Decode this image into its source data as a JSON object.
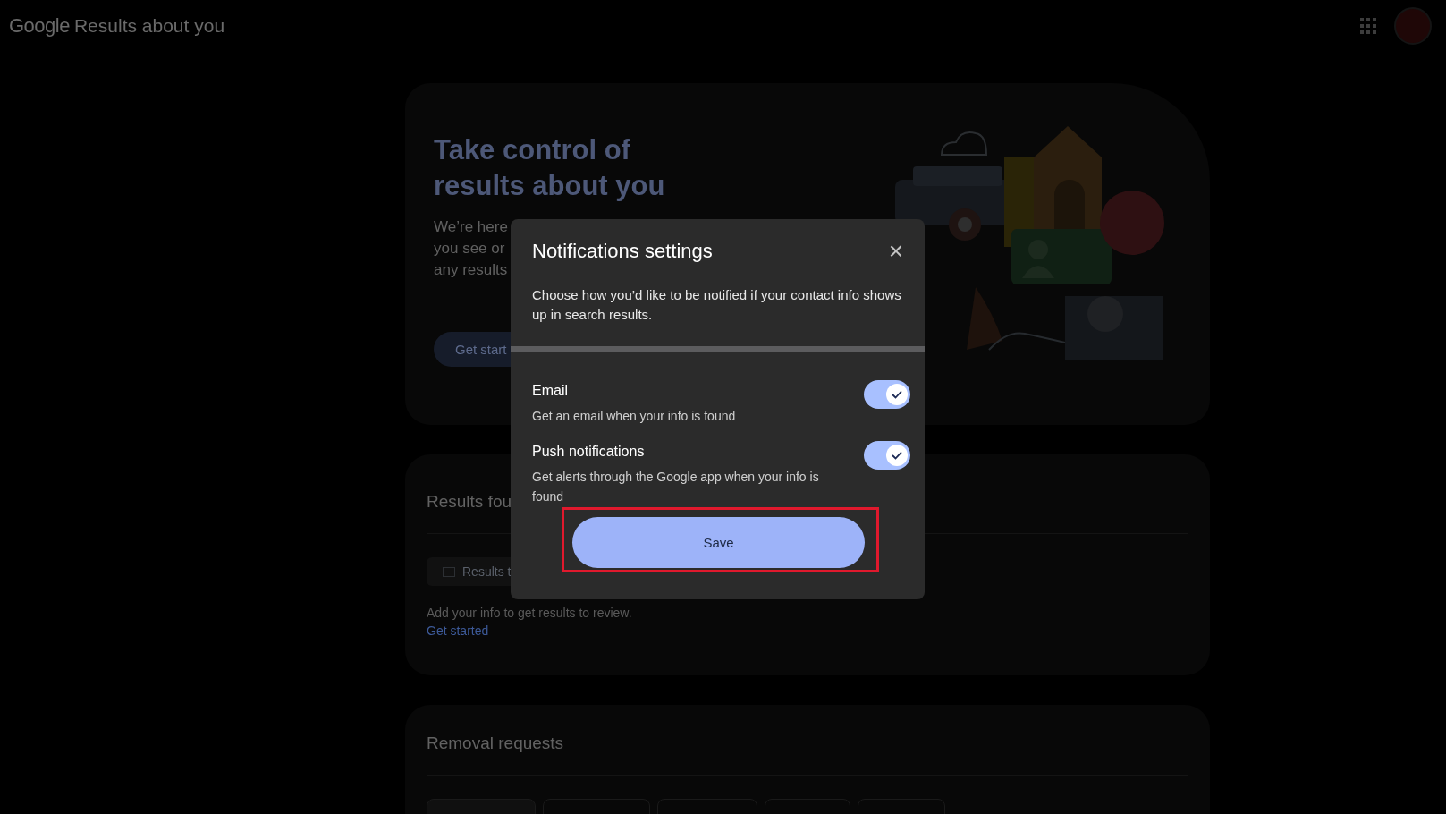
{
  "header": {
    "logo": "Google",
    "product": "Results about you"
  },
  "hero": {
    "title": "Take control of results about you",
    "body_lines": [
      "We’re here",
      "you see or",
      "any results"
    ],
    "button": "Get start"
  },
  "results_card": {
    "title": "Results fou",
    "chip": "Results t",
    "empty_text": "Add your info to get results to review.",
    "link": "Get started"
  },
  "removal_card": {
    "title": "Removal requests"
  },
  "dialog": {
    "title": "Notifications settings",
    "close": "×",
    "description": "Choose how you’d like to be notified if your contact info shows up in search results.",
    "options": [
      {
        "label": "Email",
        "description": "Get an email when your info is found",
        "on": true
      },
      {
        "label": "Push notifications",
        "description": "Get alerts through the Google app when your info is found",
        "on": true
      }
    ],
    "save": "Save",
    "save_highlighted": true
  }
}
